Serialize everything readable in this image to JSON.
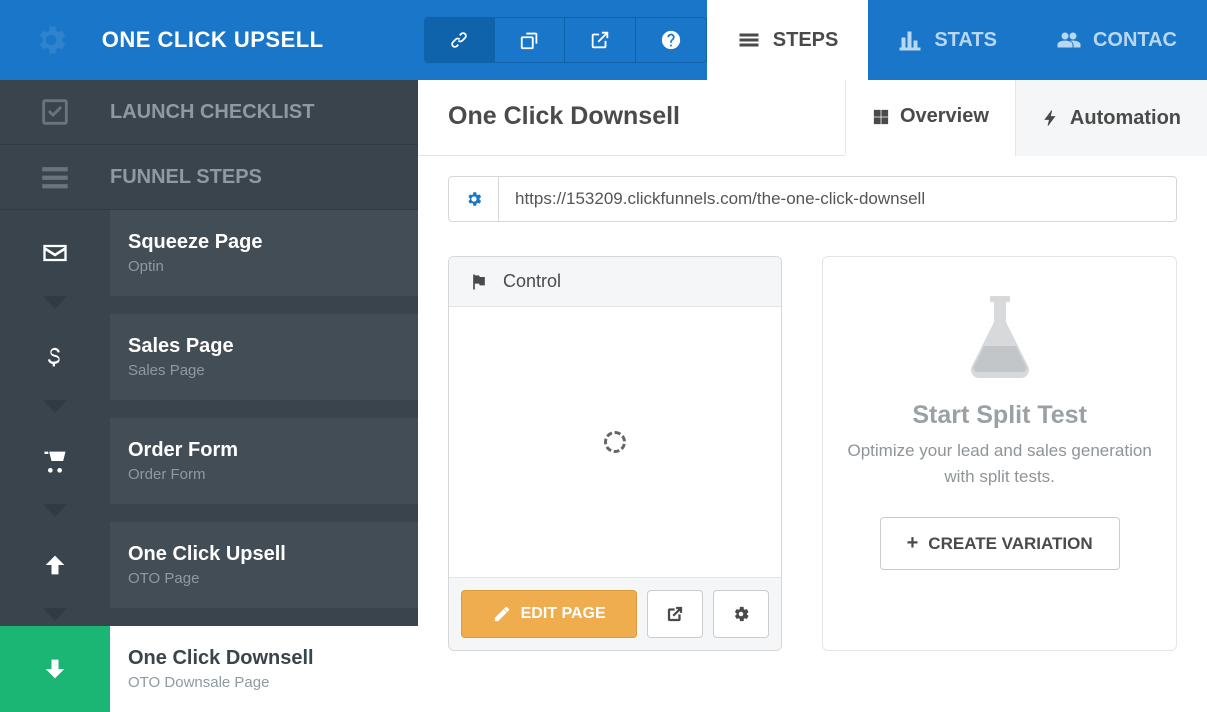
{
  "brand": "ONE CLICK UPSELL",
  "top_tabs": {
    "steps": "STEPS",
    "stats": "STATS",
    "contacts": "CONTAC"
  },
  "sidebar": {
    "checklist": "LAUNCH CHECKLIST",
    "funnel_steps": "FUNNEL STEPS",
    "steps": [
      {
        "title": "Squeeze Page",
        "sub": "Optin"
      },
      {
        "title": "Sales Page",
        "sub": "Sales Page"
      },
      {
        "title": "Order Form",
        "sub": "Order Form"
      },
      {
        "title": "One Click Upsell",
        "sub": "OTO Page"
      },
      {
        "title": "One Click Downsell",
        "sub": "OTO Downsale Page"
      }
    ]
  },
  "page": {
    "title": "One Click Downsell",
    "sub_tabs": {
      "overview": "Overview",
      "automation": "Automation"
    },
    "url": "https://153209.clickfunnels.com/the-one-click-downsell"
  },
  "control": {
    "label": "Control",
    "edit": "EDIT PAGE"
  },
  "split": {
    "title": "Start Split Test",
    "sub": "Optimize your lead and sales generation with split tests.",
    "button": "CREATE VARIATION"
  }
}
